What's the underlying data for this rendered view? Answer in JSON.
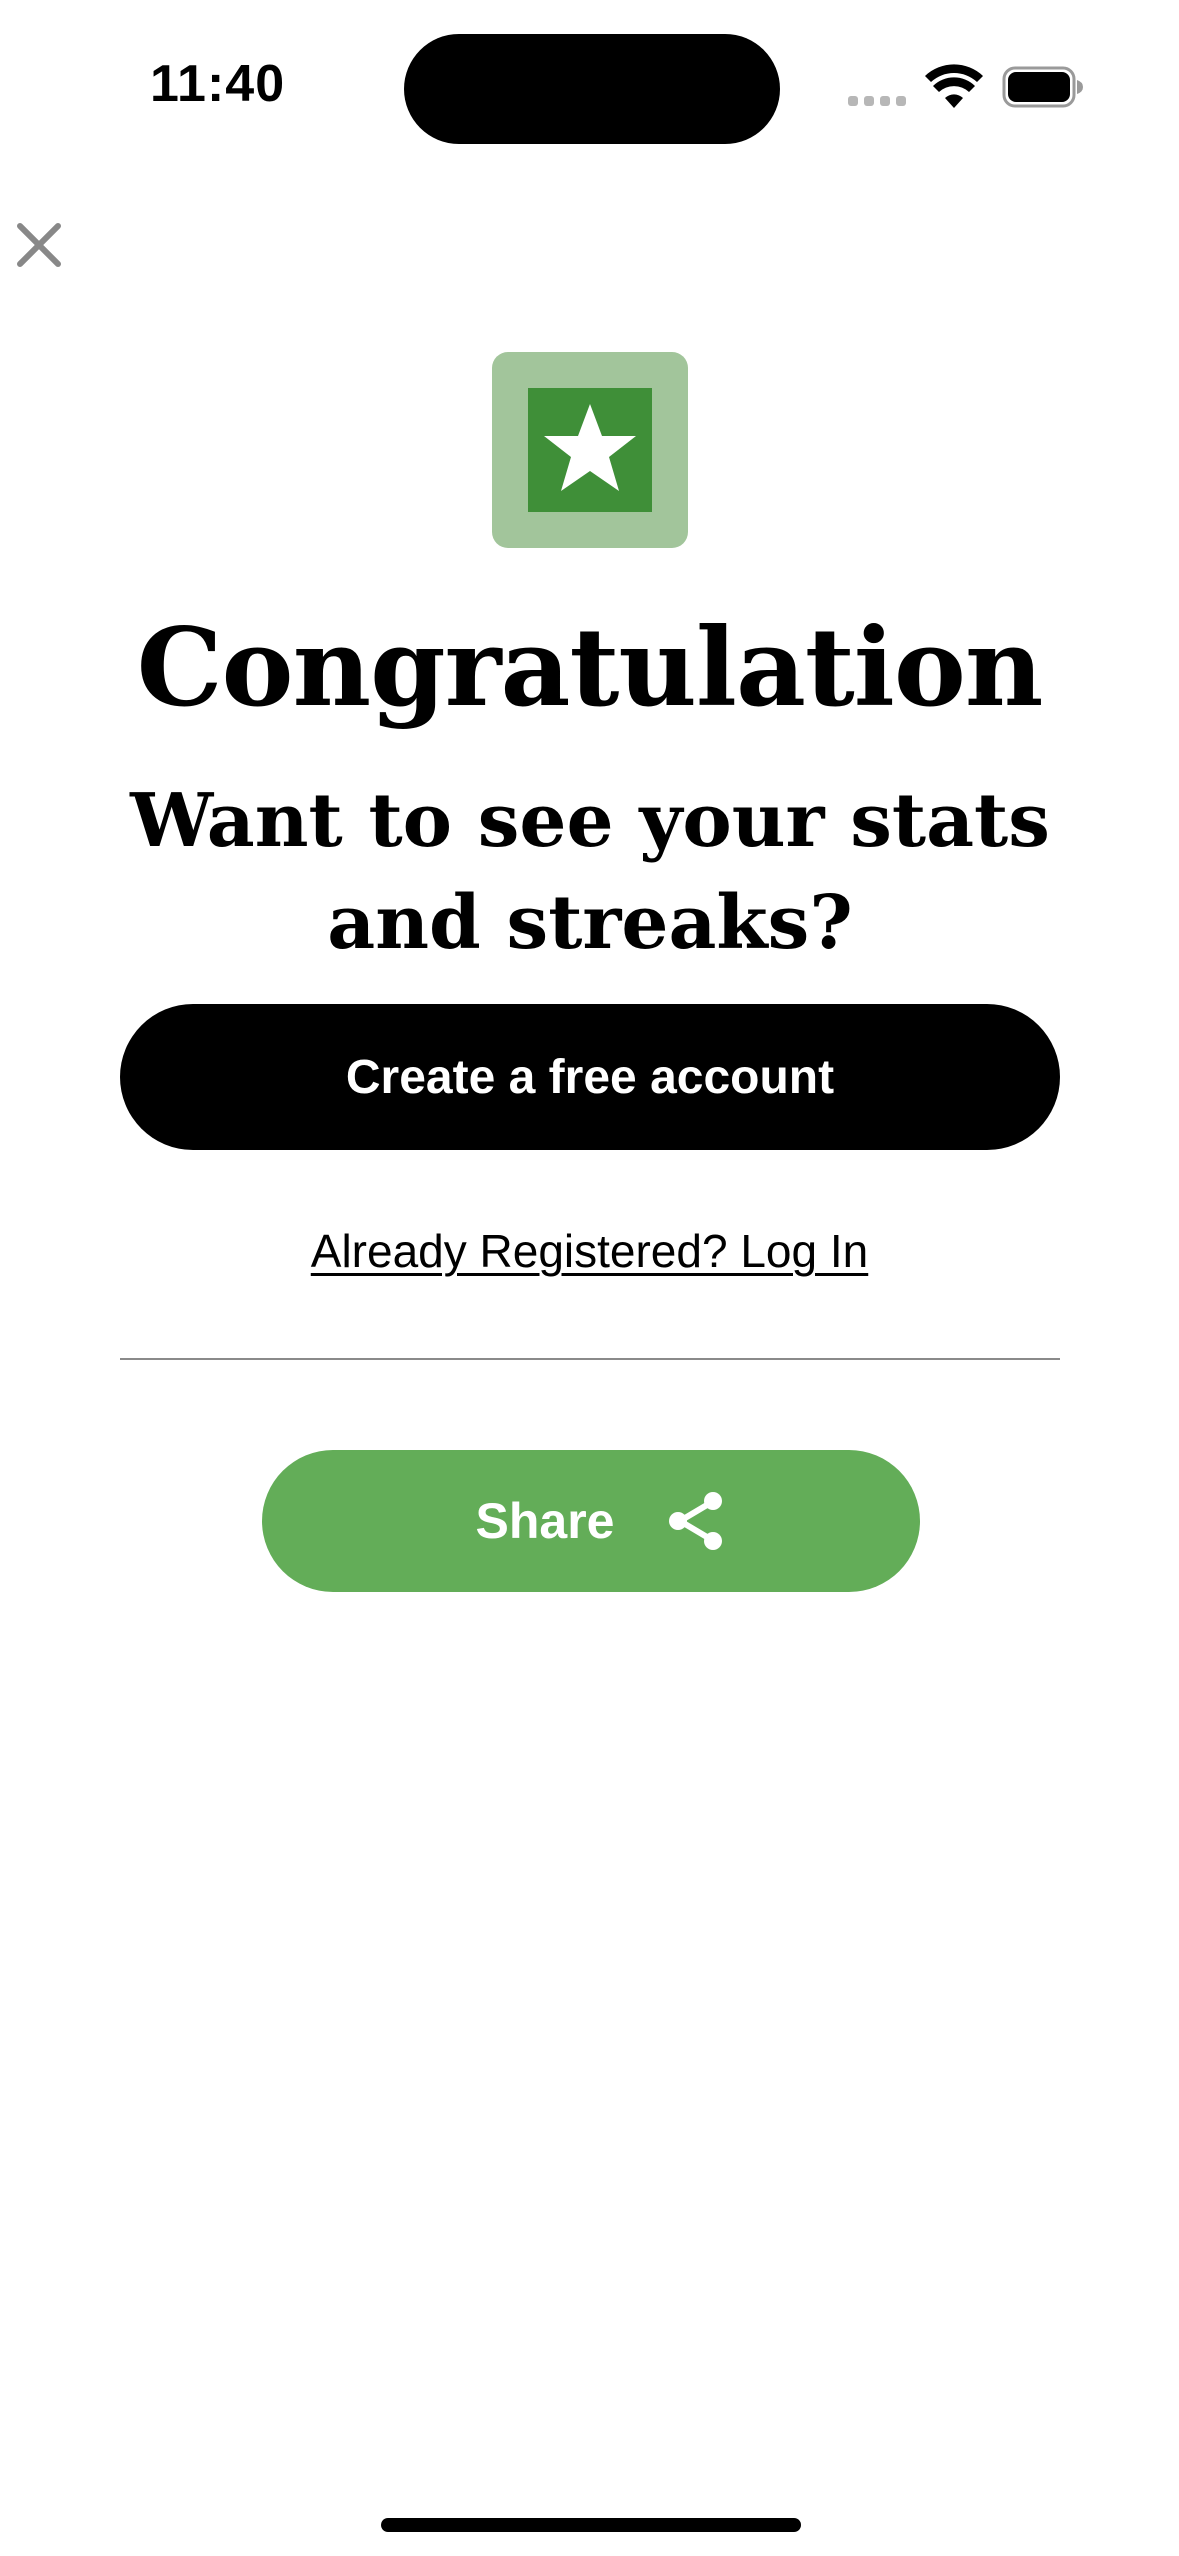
{
  "status_bar": {
    "time": "11:40"
  },
  "close_button": {
    "icon": "close-icon"
  },
  "badge": {
    "icon": "star-icon",
    "outer_color": "#a2c59b",
    "inner_color": "#3f8f38"
  },
  "main": {
    "title": "Congratulation",
    "subtitle": "Want to see your stats and streaks?",
    "create_account_label": "Create a free account",
    "login_link_label": "Already Registered? Log In",
    "share_label": "Share",
    "share_icon": "share-icon",
    "share_color": "#63ad58"
  }
}
